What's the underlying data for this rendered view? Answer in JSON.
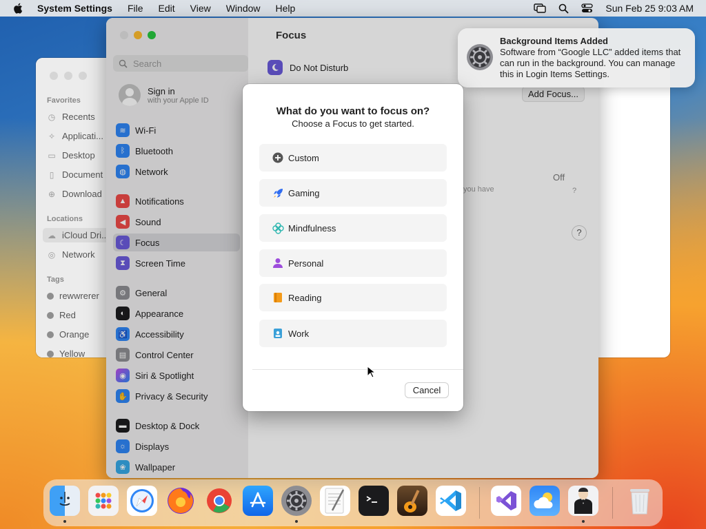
{
  "menubar": {
    "app_name": "System Settings",
    "menus": [
      "File",
      "Edit",
      "View",
      "Window",
      "Help"
    ],
    "datetime": "Sun Feb 25  9:03 AM"
  },
  "finder": {
    "favorites_header": "Favorites",
    "favorites": [
      "Recents",
      "Applicati...",
      "Desktop",
      "Document",
      "Download"
    ],
    "locations_header": "Locations",
    "locations": [
      "iCloud Dri...",
      "Network"
    ],
    "tags_header": "Tags",
    "tags": [
      {
        "label": "rewwrerer",
        "color": "#8e8e8e"
      },
      {
        "label": "Red",
        "color": "#8e8e8e"
      },
      {
        "label": "Orange",
        "color": "#8e8e8e"
      },
      {
        "label": "Yellow",
        "color": "#8e8e8e"
      }
    ]
  },
  "settings": {
    "title": "Focus",
    "search_placeholder": "Search",
    "signin_title": "Sign in",
    "signin_subtitle": "with your Apple ID",
    "sidebar": [
      {
        "label": "Wi-Fi",
        "color": "#2f86f6"
      },
      {
        "label": "Bluetooth",
        "color": "#2f86f6"
      },
      {
        "label": "Network",
        "color": "#2f86f6"
      },
      {
        "label": "Notifications",
        "color": "#ef4a48"
      },
      {
        "label": "Sound",
        "color": "#ef4a48"
      },
      {
        "label": "Focus",
        "color": "#6a5bdc"
      },
      {
        "label": "Screen Time",
        "color": "#6a5bdc"
      },
      {
        "label": "General",
        "color": "#8e8e93"
      },
      {
        "label": "Appearance",
        "color": "#1c1c1e"
      },
      {
        "label": "Accessibility",
        "color": "#2f86f6"
      },
      {
        "label": "Control Center",
        "color": "#8e8e93"
      },
      {
        "label": "Siri & Spotlight",
        "color": "#c04de8"
      },
      {
        "label": "Privacy & Security",
        "color": "#2f86f6"
      },
      {
        "label": "Desktop & Dock",
        "color": "#1c1c1e"
      },
      {
        "label": "Displays",
        "color": "#2f86f6"
      },
      {
        "label": "Wallpaper",
        "color": "#36a9e6"
      }
    ],
    "dnd_label": "Do Not Disturb",
    "add_focus_label": "Add Focus...",
    "off_label": "Off",
    "you_have_text": "you have",
    "question_mark": "?",
    "help_label": "?"
  },
  "notification": {
    "title": "Background Items Added",
    "body": "Software from “Google LLC” added items that can run in the background. You can manage this in Login Items Settings."
  },
  "sheet": {
    "question": "What do you want to focus on?",
    "subtitle": "Choose a Focus to get started.",
    "options": [
      {
        "label": "Custom",
        "icon": "plus-circle-icon",
        "color": "#555555"
      },
      {
        "label": "Gaming",
        "icon": "rocket-icon",
        "color": "#2f6cf0"
      },
      {
        "label": "Mindfulness",
        "icon": "flower-icon",
        "color": "#2fb7b0"
      },
      {
        "label": "Personal",
        "icon": "person-icon",
        "color": "#9d4ddc"
      },
      {
        "label": "Reading",
        "icon": "book-icon",
        "color": "#f39a1a"
      },
      {
        "label": "Work",
        "icon": "badge-icon",
        "color": "#3aa0d8"
      }
    ],
    "cancel_label": "Cancel"
  },
  "dock": {
    "apps": [
      "Finder",
      "Launchpad",
      "Safari",
      "Firefox",
      "Chrome",
      "App Store",
      "System Settings",
      "TextEdit",
      "Terminal",
      "GarageBand",
      "VS Code",
      "Visual Studio",
      "Weather",
      "Bartender",
      "Trash"
    ]
  }
}
